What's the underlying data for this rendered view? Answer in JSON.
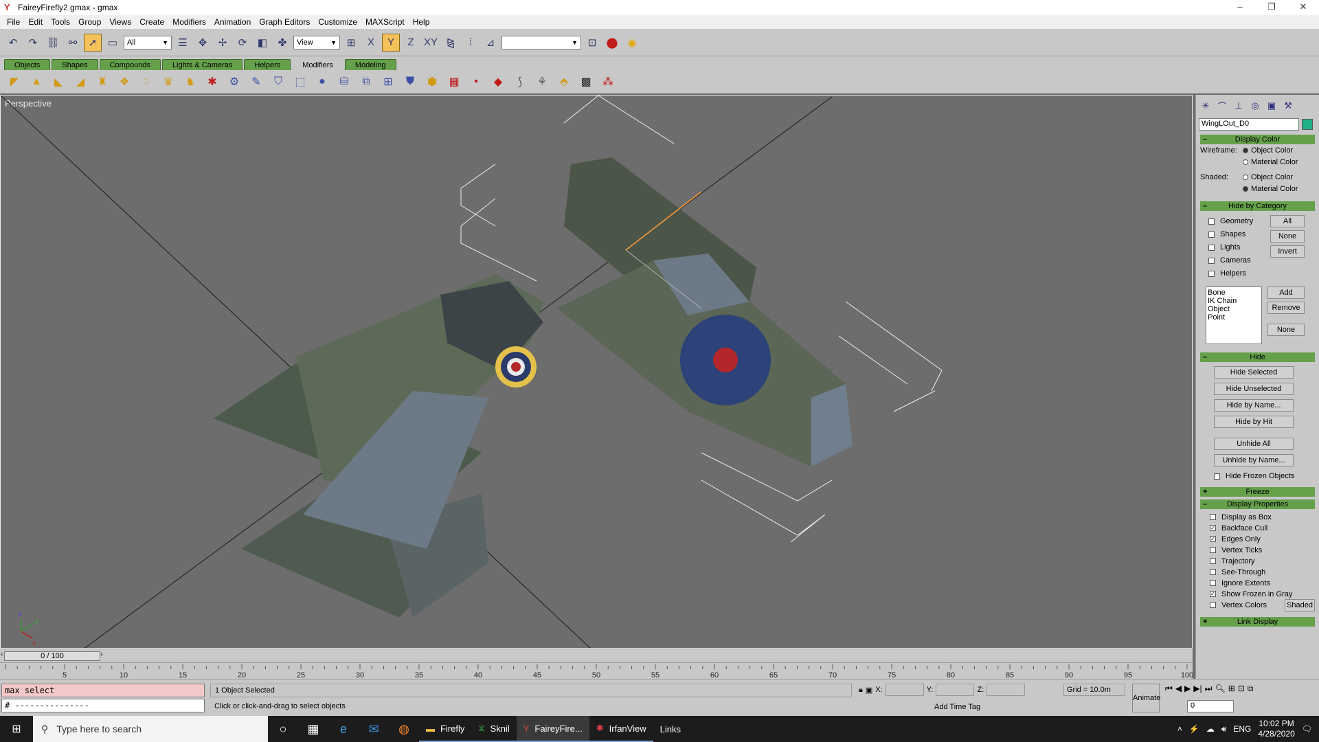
{
  "window": {
    "title": "FaireyFirefly2.gmax - gmax",
    "min": "–",
    "max": "❐",
    "close": "✕"
  },
  "menu": [
    "File",
    "Edit",
    "Tools",
    "Group",
    "Views",
    "Create",
    "Modifiers",
    "Animation",
    "Graph Editors",
    "Customize",
    "MAXScript",
    "Help"
  ],
  "toolbar": {
    "selection_filter": "All",
    "ref_coord": "View",
    "named_selection": ""
  },
  "tabs": [
    "Objects",
    "Shapes",
    "Compounds",
    "Lights & Cameras",
    "Helpers",
    "Modifiers",
    "Modeling"
  ],
  "active_tab": "Modifiers",
  "viewport": {
    "label": "Perspective"
  },
  "command_panel": {
    "object_name": "WingLOut_D0",
    "object_color": "#1fb08a",
    "display_color": {
      "title": "Display Color",
      "wireframe_label": "Wireframe:",
      "shaded_label": "Shaded:",
      "options": [
        "Object Color",
        "Material Color"
      ]
    },
    "hide_by_category": {
      "title": "Hide by Category",
      "items": [
        "Geometry",
        "Shapes",
        "Lights",
        "Cameras",
        "Helpers"
      ],
      "buttons": [
        "All",
        "None",
        "Invert"
      ],
      "list": [
        "Bone",
        "IK Chain Object",
        "Point"
      ],
      "list_buttons": [
        "Add",
        "Remove",
        "None"
      ]
    },
    "hide": {
      "title": "Hide",
      "buttons": [
        "Hide Selected",
        "Hide Unselected",
        "Hide by Name...",
        "Hide by Hit",
        "Unhide All",
        "Unhide by Name..."
      ],
      "hide_frozen": "Hide Frozen Objects"
    },
    "freeze": {
      "title": "Freeze"
    },
    "display_properties": {
      "title": "Display Properties",
      "items": [
        {
          "label": "Display as Box",
          "checked": false
        },
        {
          "label": "Backface Cull",
          "checked": true
        },
        {
          "label": "Edges Only",
          "checked": true
        },
        {
          "label": "Vertex Ticks",
          "checked": false
        },
        {
          "label": "Trajectory",
          "checked": false
        },
        {
          "label": "See-Through",
          "checked": false
        },
        {
          "label": "Ignore Extents",
          "checked": false
        },
        {
          "label": "Show Frozen in Gray",
          "checked": true
        },
        {
          "label": "Vertex Colors",
          "checked": false
        }
      ],
      "shaded_button": "Shaded"
    },
    "link_display": {
      "title": "Link Display"
    }
  },
  "timeline": {
    "slider_label": "0 / 100",
    "ticks": [
      "5",
      "10",
      "15",
      "20",
      "25",
      "30",
      "35",
      "40",
      "45",
      "50",
      "55",
      "60",
      "65",
      "70",
      "75",
      "80",
      "85",
      "90",
      "95",
      "100"
    ]
  },
  "status": {
    "maxscript_line1": "max select",
    "maxscript_line2": "# ---------------",
    "selection": "1 Object Selected",
    "prompt": "Click or click-and-drag to select objects",
    "x_label": "X:",
    "y_label": "Y:",
    "z_label": "Z:",
    "grid": "Grid = 10.0m",
    "time_tag": "Add Time Tag",
    "animate": "Animate",
    "frame": "0"
  },
  "taskbar": {
    "search_placeholder": "Type here to search",
    "tasks": [
      "Firefly",
      "Sknil",
      "FaireyFire...",
      "IrfanView",
      "Links"
    ],
    "lang": "ENG",
    "time": "10:02 PM",
    "date": "4/28/2020"
  }
}
